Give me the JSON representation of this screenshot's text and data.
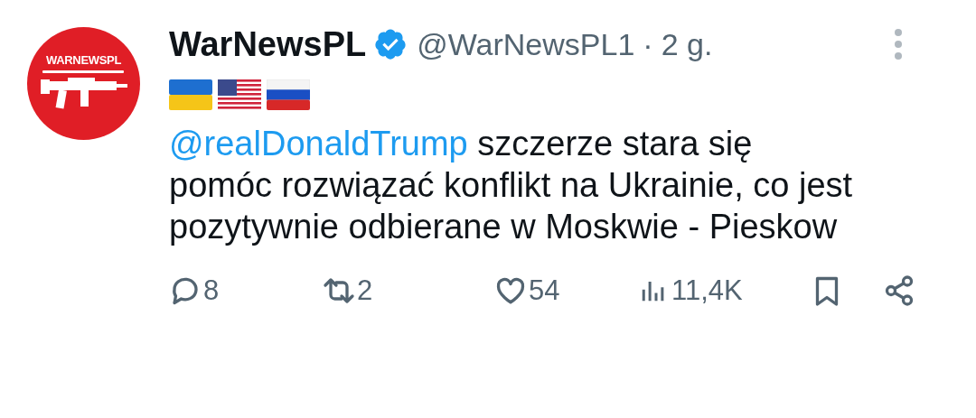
{
  "post": {
    "avatar": {
      "logo_text": "WARNEWSPL"
    },
    "author": {
      "name": "WarNewsPL",
      "verified": true,
      "handle": "@WarNewsPL1",
      "separator": "·",
      "time": "2 g."
    },
    "flags": [
      {
        "kind": "ukraine"
      },
      {
        "kind": "usa"
      },
      {
        "kind": "russia"
      }
    ],
    "body": {
      "mention": "@realDonaldTrump",
      "text": " szczerze stara się pomóc rozwiązać konflikt na Ukrainie, co jest pozytywnie odbierane w Moskwie - Pieskow"
    },
    "actions": [
      {
        "kind": "reply",
        "count": "8"
      },
      {
        "kind": "repost",
        "count": "2"
      },
      {
        "kind": "like",
        "count": "54"
      },
      {
        "kind": "views",
        "count": "11,4K"
      },
      {
        "kind": "bookmark"
      },
      {
        "kind": "share"
      }
    ]
  }
}
